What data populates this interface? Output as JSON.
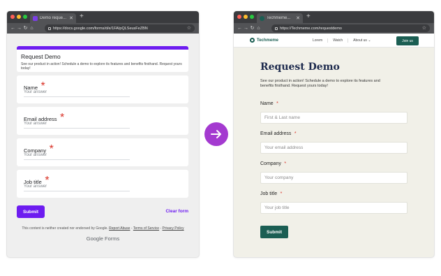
{
  "left": {
    "tab_title": "Demo reque...",
    "url": "https://docs.google.com/forms/d/e/1FAIpQLSeusFeZBN",
    "form": {
      "title": "Request Demo",
      "description": "See our product in action! Schedule a demo to explore its features and benefits firsthand. Request yours today!",
      "fields": [
        {
          "label": "Name",
          "required": "*",
          "placeholder": "Your answer"
        },
        {
          "label": "Email address",
          "required": "*",
          "placeholder": "Your answer"
        },
        {
          "label": "Company",
          "required": "*",
          "placeholder": "Your answer"
        },
        {
          "label": "Job title",
          "required": "*",
          "placeholder": "Your answer"
        }
      ],
      "submit_label": "Submit",
      "clear_label": "Clear form",
      "footer_text": "This content is neither created nor endorsed by Google.",
      "report_abuse": "Report Abuse",
      "terms": "Terms of Service",
      "privacy": "Privacy Policy",
      "sep": "-",
      "brand": "Google Forms"
    },
    "accent": "#6d1cf0"
  },
  "right": {
    "tab_title": "Techmeme...",
    "url": "https://Techmeme.com/requestdemo",
    "site": {
      "logo": "Techmeme",
      "nav": [
        "Lorem",
        "Watch",
        "About us"
      ],
      "cta": "Join us"
    },
    "form": {
      "title": "Request Demo",
      "description": "See our product in action! Schedule a demo to explore its features and benefits firsthand. Request yours today!",
      "fields": [
        {
          "label": "Name",
          "required": "*",
          "placeholder": "First & Last name"
        },
        {
          "label": "Email address",
          "required": "*",
          "placeholder": "Your email address"
        },
        {
          "label": "Company",
          "required": "*",
          "placeholder": "Your company"
        },
        {
          "label": "Job title",
          "required": "*",
          "placeholder": "Your job title"
        }
      ],
      "submit_label": "Submit"
    },
    "accent": "#1b5e53"
  },
  "arrow_color": "#a43ad0",
  "icons": {
    "back": "arrow-left-icon",
    "forward": "arrow-right-icon",
    "reload": "reload-icon",
    "home": "home-icon",
    "lock": "lock-icon",
    "star": "star-icon",
    "close": "close-icon",
    "new_tab": "plus-icon",
    "transform": "arrow-right-circle-icon"
  }
}
